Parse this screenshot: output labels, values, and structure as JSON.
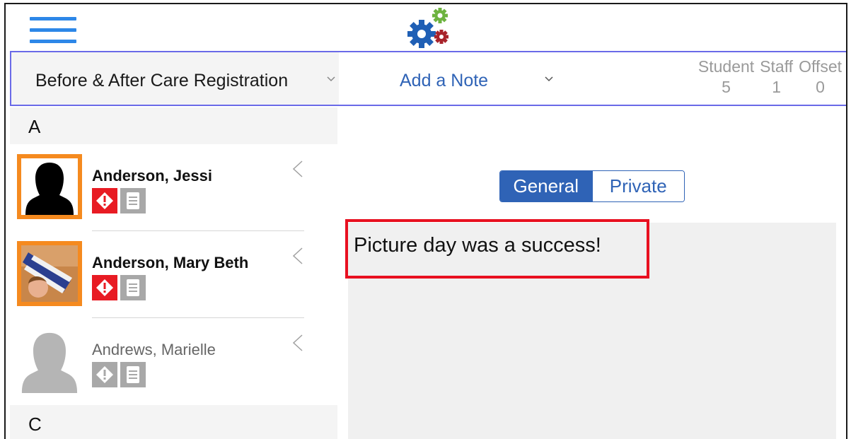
{
  "header": {
    "program_label": "Before & After Care Registration",
    "note_label": "Add a Note",
    "counts": [
      {
        "label": "Student",
        "value": "5"
      },
      {
        "label": "Staff",
        "value": "1"
      },
      {
        "label": "Offset",
        "value": "0"
      }
    ]
  },
  "list": {
    "sections": [
      {
        "letter": "A"
      },
      {
        "letter": "C"
      }
    ],
    "rows": [
      {
        "name": "Anderson, Jessi"
      },
      {
        "name": "Anderson, Mary Beth"
      },
      {
        "name": "Andrews, Marielle"
      }
    ]
  },
  "tabs": {
    "general": "General",
    "private": "Private"
  },
  "note": {
    "text": "Picture day was a success!"
  },
  "colors": {
    "accent_blue": "#2f63b6",
    "menu_blue": "#2d87e8",
    "alert_red": "#e81b23",
    "avatar_border": "#f58a1f",
    "highlight_red": "#e81020"
  }
}
